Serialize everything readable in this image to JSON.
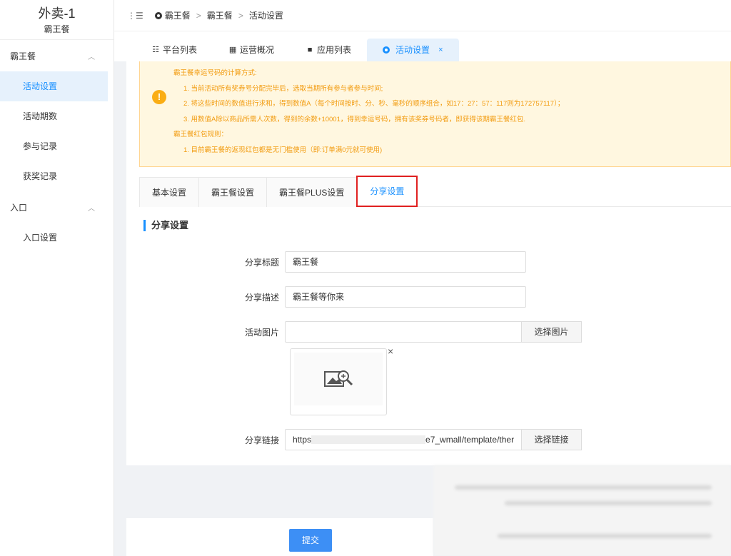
{
  "brand": {
    "title": "外卖-1",
    "subtitle": "霸王餐"
  },
  "sidebar": {
    "groups": [
      {
        "label": "霸王餐",
        "items": [
          "活动设置",
          "活动期数",
          "参与记录",
          "获奖记录"
        ]
      },
      {
        "label": "入口",
        "items": [
          "入口设置"
        ]
      }
    ],
    "active_item": "活动设置"
  },
  "breadcrumb": {
    "toggle": "⋮☰",
    "items": [
      "霸王餐",
      "霸王餐",
      "活动设置"
    ],
    "separator": ">"
  },
  "tabs": [
    {
      "label": "平台列表",
      "icon": "list-icon"
    },
    {
      "label": "运营概况",
      "icon": "grid-icon"
    },
    {
      "label": "应用列表",
      "icon": "apps-icon"
    },
    {
      "label": "活动设置",
      "icon": "gear-icon",
      "active": true,
      "close": "×"
    }
  ],
  "notice": {
    "icon": "!",
    "lines": [
      "霸王餐幸运号码的计算方式:",
      "1. 当前活动所有奖券号分配完毕后，选取当期所有参与者参与时间;",
      "2. 将这些时间的数值进行求和，得到数值A（每个时间按时、分、秒、毫秒的顺序组合，如17：27：57：117则为172757117）；",
      "3. 用数值A除以商品所需人次数，得到的余数+10001，得到幸运号码，拥有该奖券号码者，即获得该期霸王餐红包.",
      "霸王餐红包规则：",
      "1. 目前霸王餐的返现红包都是无门槛使用（即:订单满0元就可使用)"
    ]
  },
  "subtabs": [
    "基本设置",
    "霸王餐设置",
    "霸王餐PLUS设置",
    "分享设置"
  ],
  "section_title": "分享设置",
  "form": {
    "share_title_label": "分享标题",
    "share_title_value": "霸王餐",
    "share_desc_label": "分享描述",
    "share_desc_value": "霸王餐等你来",
    "image_label": "活动图片",
    "image_value": "",
    "image_button": "选择图片",
    "image_close": "×",
    "link_label": "分享链接",
    "link_value_start": "https",
    "link_value_end": "e7_wmall/template/ther",
    "link_button": "选择链接"
  },
  "submit_label": "提交",
  "colors": {
    "accent": "#1890ff",
    "warning": "#f29c11",
    "highlight": "#e02020",
    "submit": "#3d8ff5"
  }
}
